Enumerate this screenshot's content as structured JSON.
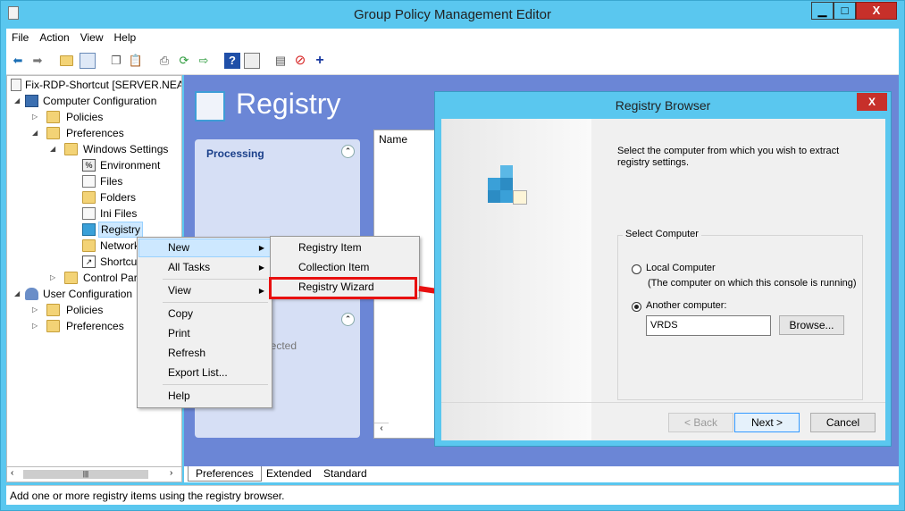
{
  "window": {
    "title": "Group Policy Management Editor",
    "buttons": {
      "minimize": "▁",
      "maximize": "□",
      "close": "X"
    }
  },
  "menu": [
    "File",
    "Action",
    "View",
    "Help"
  ],
  "toolbar_icons": [
    "back-arrow-icon",
    "forward-arrow-icon",
    "up-folder-icon",
    "show-hide-tree-icon",
    "copy-icon",
    "paste-icon",
    "print-icon",
    "refresh-icon",
    "export-icon",
    "help-icon",
    "properties-icon",
    "new-icon",
    "stop-icon",
    "add-icon"
  ],
  "tree": {
    "items": [
      {
        "label": "Fix-RDP-Shortcut [SERVER.NEA",
        "level": 0
      },
      {
        "label": "Computer Configuration",
        "level": 1
      },
      {
        "label": "Policies",
        "level": 2
      },
      {
        "label": "Preferences",
        "level": 2
      },
      {
        "label": "Windows Settings",
        "level": 3
      },
      {
        "label": "Environment",
        "level": 4
      },
      {
        "label": "Files",
        "level": 4
      },
      {
        "label": "Folders",
        "level": 4
      },
      {
        "label": "Ini Files",
        "level": 4
      },
      {
        "label": "Registry",
        "level": 4
      },
      {
        "label": "Network",
        "level": 4
      },
      {
        "label": "Shortcut",
        "level": 4
      },
      {
        "label": "Control Par",
        "level": 3
      },
      {
        "label": "User Configuration",
        "level": 1
      },
      {
        "label": "Policies",
        "level": 2
      },
      {
        "label": "Preferences",
        "level": 2
      }
    ]
  },
  "content": {
    "title": "Registry",
    "processing_label": "Processing",
    "name_column": "Name",
    "selected_text": "lected"
  },
  "context_menu": {
    "items": [
      "New",
      "All Tasks",
      "View",
      "Copy",
      "Print",
      "Refresh",
      "Export List...",
      "Help"
    ]
  },
  "submenu": {
    "items": [
      "Registry Item",
      "Collection Item",
      "Registry Wizard"
    ]
  },
  "tabs": [
    "Preferences",
    "Extended",
    "Standard"
  ],
  "status": "Add one or more registry items using the registry browser.",
  "dialog": {
    "title": "Registry Browser",
    "close": "X",
    "instruction": "Select the computer from which you wish to extract registry settings.",
    "group_label": "Select Computer",
    "local_label": "Local Computer",
    "local_desc": "(The computer on which this console is running)",
    "another_label": "Another computer:",
    "computer_value": "VRDS",
    "browse": "Browse...",
    "back": "< Back",
    "next": "Next >",
    "cancel": "Cancel"
  },
  "colors": {
    "accent": "#5ac7ef",
    "content_bg": "#6b86d6",
    "highlight": "#e81010"
  }
}
